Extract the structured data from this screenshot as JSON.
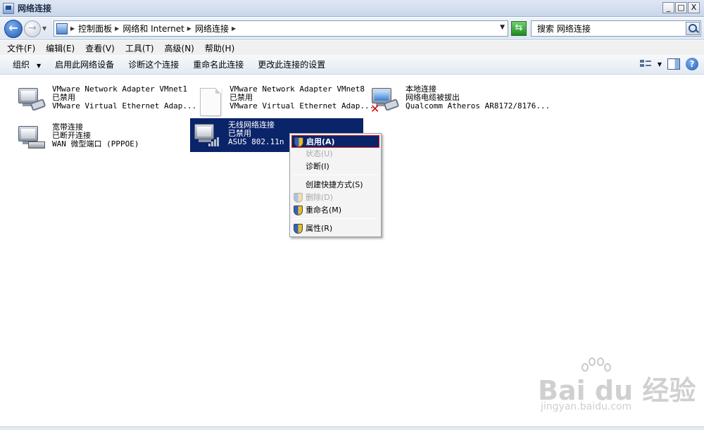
{
  "window": {
    "title": "网络连接",
    "controls": {
      "minimize": "_",
      "maximize": "□",
      "close": "X"
    }
  },
  "address": {
    "back": "←",
    "forward": "→",
    "crumbs": [
      "控制面板",
      "网络和 Internet",
      "网络连接"
    ],
    "refresh": "⇆"
  },
  "search": {
    "value": "搜索 网络连接"
  },
  "menu": [
    "文件(F)",
    "编辑(E)",
    "查看(V)",
    "工具(T)",
    "高级(N)",
    "帮助(H)"
  ],
  "toolbar": {
    "organize": "组织",
    "enable": "启用此网络设备",
    "diagnose": "诊断这个连接",
    "rename": "重命名此连接",
    "change_settings": "更改此连接的设置",
    "help": "?"
  },
  "connections": [
    {
      "name": "VMware Network Adapter VMnet1",
      "status": "已禁用",
      "device": "VMware Virtual Ethernet Adap..."
    },
    {
      "name": "VMware Network Adapter VMnet8",
      "status": "已禁用",
      "device": "VMware Virtual Ethernet Adap..."
    },
    {
      "name": "本地连接",
      "status": "网络电缆被拔出",
      "device": "Qualcomm Atheros AR8172/8176..."
    },
    {
      "name": "宽带连接",
      "status": "已断开连接",
      "device": "WAN 微型端口 (PPPOE)"
    },
    {
      "name": "无线网络连接",
      "status": "已禁用",
      "device": "ASUS 802.11n 网"
    }
  ],
  "context_menu": {
    "enable": "启用(A)",
    "status": "状态(U)",
    "diagnose": "诊断(I)",
    "shortcut": "创建快捷方式(S)",
    "delete": "删除(D)",
    "rename": "重命名(M)",
    "properties": "属性(R)"
  },
  "watermark": {
    "brand": "Bai du 经验",
    "url": "jingyan.baidu.com"
  },
  "colors": {
    "selection": "#0a246a",
    "highlight_border": "#e01c1c",
    "error": "#d40000"
  }
}
